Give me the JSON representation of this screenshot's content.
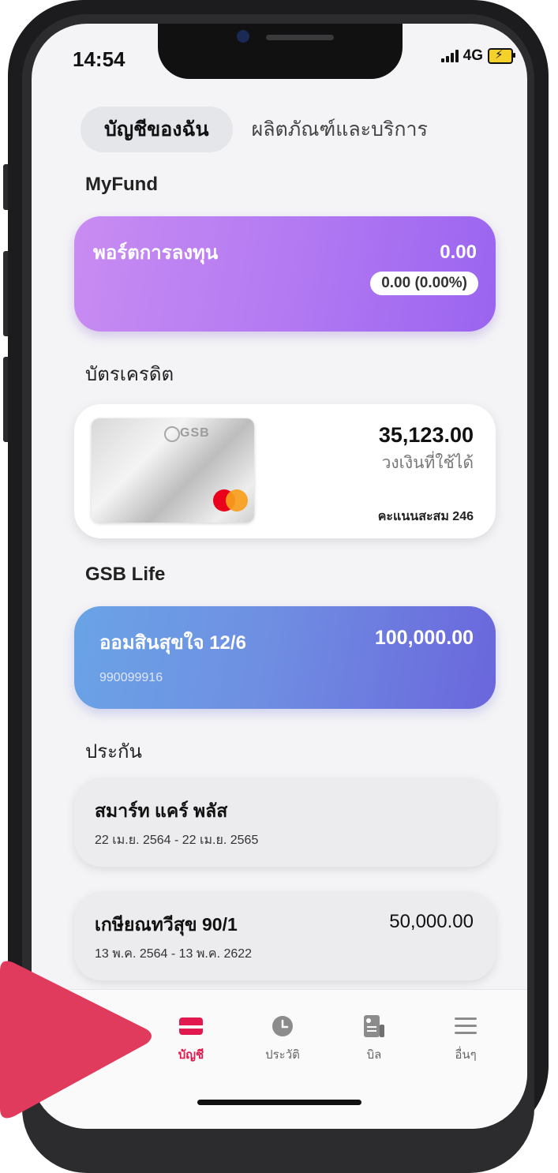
{
  "status_bar": {
    "time": "14:54",
    "network": "4G"
  },
  "tabs": [
    {
      "label": "บัญชีของฉัน",
      "active": true
    },
    {
      "label": "ผลิตภัณฑ์และบริการ",
      "active": false
    }
  ],
  "myfund": {
    "section_title": "MyFund",
    "card_title": "พอร์ตการลงทุน",
    "value": "0.00",
    "change": "0.00 (0.00%)"
  },
  "credit": {
    "section_title": "บัตรเครดิต",
    "card_brand": "GSB",
    "amount": "35,123.00",
    "amount_label": "วงเงินที่ใช้ได้",
    "points": "คะแนนสะสม 246"
  },
  "gsb_life": {
    "section_title": "GSB Life",
    "name": "ออมสินสุขใจ 12/6",
    "amount": "100,000.00",
    "account_number": "990099916"
  },
  "insurance": {
    "section_title": "ประกัน",
    "items": [
      {
        "name": "สมาร์ท แคร์ พลัส",
        "date": "22 เม.ย. 2564 - 22 เม.ย. 2565",
        "amount": ""
      },
      {
        "name": "เกษียณทวีสุข 90/1",
        "date": "13 พ.ค. 2564 - 13 พ.ค. 2622",
        "amount": "50,000.00"
      }
    ]
  },
  "bottom_nav": [
    {
      "label": "บัญชี",
      "icon": "wallet-icon",
      "active": true
    },
    {
      "label": "ประวัติ",
      "icon": "clock-icon",
      "active": false
    },
    {
      "label": "บิล",
      "icon": "bill-icon",
      "active": false
    },
    {
      "label": "อื่นๆ",
      "icon": "menu-icon",
      "active": false
    }
  ],
  "colors": {
    "accent": "#e2194e",
    "fund_gradient": [
      "#c98cf2",
      "#9a64f0"
    ],
    "life_gradient": [
      "#6aa3e6",
      "#6a66dc"
    ],
    "play_overlay": "#e03a5c"
  }
}
